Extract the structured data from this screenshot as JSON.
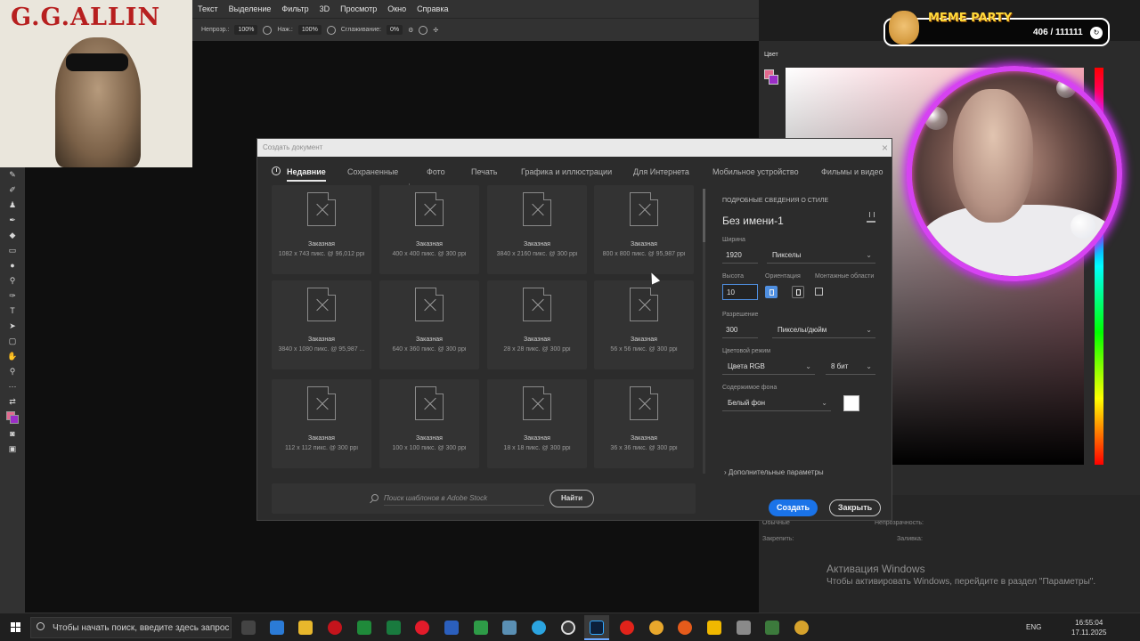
{
  "photoshop": {
    "menu": [
      "Текст",
      "Выделение",
      "Фильтр",
      "3D",
      "Просмотр",
      "Окно",
      "Справка"
    ],
    "options": {
      "opacity_label": "Непрозр.:",
      "opacity_value": "100%",
      "pressure_label": "Наж.:",
      "pressure_value": "100%",
      "smoothing_label": "Сглаживание:",
      "smoothing_value": "0%"
    },
    "color_panel_title": "Цвет",
    "fg_color": "#e36a8f",
    "bg_color": "#9b2ec7",
    "layers": {
      "mode": "Обычные",
      "opacity_label": "Непрозрачность:",
      "lock_label": "Закрепить:",
      "fill_label": "Заливка:"
    }
  },
  "overlay": {
    "gg_title": "G.G.ALLIN",
    "meme_title": "MEME PARTY",
    "meme_count": "406 / 111111"
  },
  "dialog": {
    "title": "Создать документ",
    "tabs": [
      "Недавние",
      "Сохраненные",
      "Фото",
      "Печать",
      "Графика и иллюстрации",
      "Для Интернета",
      "Мобильное устройство",
      "Фильмы и видео"
    ],
    "presets": [
      {
        "name": "Заказная",
        "dims": "1082 x 743 пикс. @ 96,012 ppi"
      },
      {
        "name": "Заказная",
        "dims": "400 x 400 пикс. @ 300 ppi"
      },
      {
        "name": "Заказная",
        "dims": "3840 x 2160 пикс. @ 300 ppi"
      },
      {
        "name": "Заказная",
        "dims": "800 x 800 пикс. @ 95,987 ppi"
      },
      {
        "name": "Заказная",
        "dims": "3840 x 1080 пикс. @ 95,987 ..."
      },
      {
        "name": "Заказная",
        "dims": "640 x 360 пикс. @ 300 ppi"
      },
      {
        "name": "Заказная",
        "dims": "28 x 28 пикс. @ 300 ppi"
      },
      {
        "name": "Заказная",
        "dims": "56 x 56 пикс. @ 300 ppi"
      },
      {
        "name": "Заказная",
        "dims": "112 x 112 пикс. @ 300 ppi"
      },
      {
        "name": "Заказная",
        "dims": "100 x 100 пикс. @ 300 ppi"
      },
      {
        "name": "Заказная",
        "dims": "18 x 18 пикс. @ 300 ppi"
      },
      {
        "name": "Заказная",
        "dims": "36 x 36 пикс. @ 300 ppi"
      }
    ],
    "search_placeholder": "Поиск шаблонов в Adobe Stock",
    "find_label": "Найти",
    "details": {
      "section_title": "ПОДРОБНЫЕ СВЕДЕНИЯ О СТИЛЕ",
      "doc_name": "Без имени-1",
      "width_label": "Ширина",
      "width_value": "1920",
      "width_unit": "Пикселы",
      "height_label": "Высота",
      "height_value": "10",
      "orientation_label": "Ориентация",
      "artboards_label": "Монтажные области",
      "resolution_label": "Разрешение",
      "resolution_value": "300",
      "resolution_unit": "Пикселы/дюйм",
      "color_mode_label": "Цветовой режим",
      "color_mode_value": "Цвета RGB",
      "bit_depth": "8 бит",
      "bg_content_label": "Содержимое фона",
      "bg_content_value": "Белый фон",
      "bg_color": "#ffffff",
      "advanced_label": "Дополнительные параметры"
    },
    "create_label": "Создать",
    "close_label": "Закрыть"
  },
  "windows": {
    "activation_title": "Активация Windows",
    "activation_text": "Чтобы активировать Windows, перейдите в раздел \"Параметры\".",
    "search_text": "Чтобы начать поиск, введите здесь запрос",
    "lang": "ENG",
    "time": "16:55:04",
    "date": "17.11.2025"
  }
}
